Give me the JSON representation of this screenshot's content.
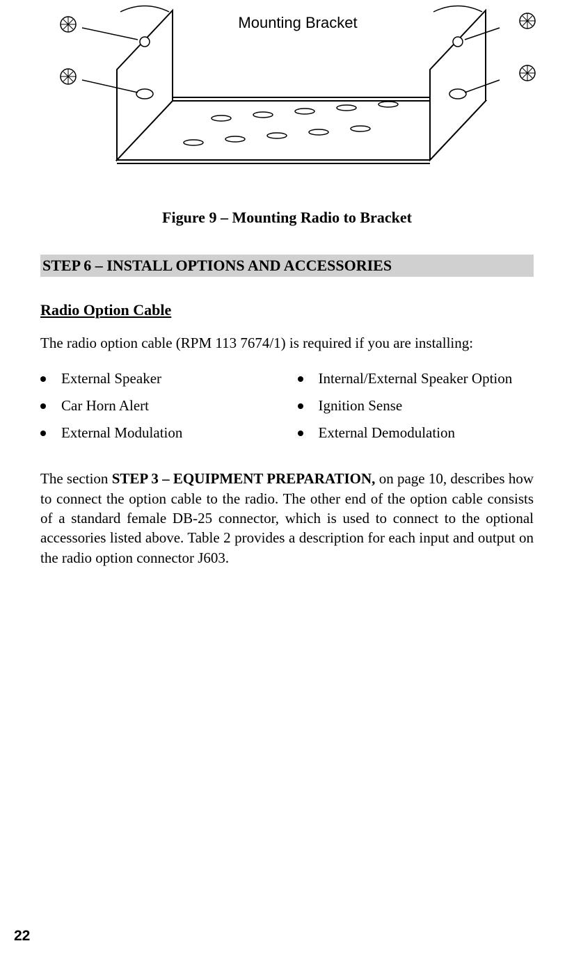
{
  "figure": {
    "label": "Mounting Bracket",
    "caption": "Figure 9 – Mounting Radio to Bracket"
  },
  "step_heading": "STEP 6 – INSTALL OPTIONS AND ACCESSORIES",
  "subheading": "Radio Option Cable",
  "intro": "The radio option cable (RPM 113 7674/1) is required if you are installing:",
  "bullets_left": [
    "External Speaker",
    "Car Horn Alert",
    "External Modulation"
  ],
  "bullets_right": [
    "Internal/External Speaker Option",
    "Ignition Sense",
    "External Demodulation"
  ],
  "body_para_pre": "The section ",
  "body_para_bold": "STEP 3 – EQUIPMENT PREPARATION,",
  "body_para_post": " on page 10, describes how to connect the option cable to the radio.  The other end of the option cable consists of a standard female DB-25 connector, which is used to connect to the optional accessories listed above.  Table 2 provides a description for each input and output on the radio option connector J603.",
  "page_number": "22"
}
